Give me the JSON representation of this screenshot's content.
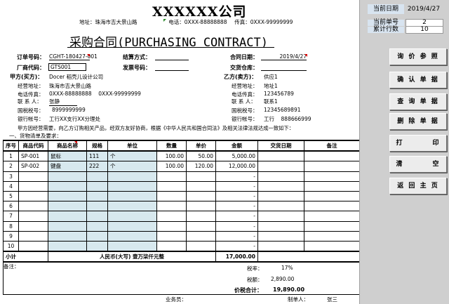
{
  "header": {
    "company": "XXXXXX公司",
    "address_label": "地址：",
    "address": "珠海市吉大景山路",
    "phone_label": "电话：",
    "phone": "0XXX-88888888",
    "fax_label": "传真：",
    "fax": "0XXX-99999999",
    "title": "采购合同(PURCHASING CONTRACT)"
  },
  "meta": {
    "order_no_label": "订单号码：",
    "order_no": "CGHT-180427-001",
    "vendor_code_label": "厂商代码：",
    "vendor_code": "GTS001",
    "settle_label": "结算方式：",
    "settle": "",
    "invoice_label": "发票号码：",
    "invoice": "",
    "date_label": "合同日期：",
    "date": "2019/4/27",
    "warehouse_label": "交货仓库：",
    "warehouse": ""
  },
  "party_a": {
    "label": "甲方(买方)：",
    "name": "Docer 稻壳儿设计公司",
    "addr_label": "经营地址：",
    "addr": "珠海市吉大景山路",
    "phone_label": "电话传真：",
    "phone": "0XXX-88888888    0XXX-99999999",
    "contact_label": "联 系 人：",
    "contact": "张静",
    "tax_label": "国税税号：",
    "tax": "8999999999",
    "bank_label": "银行帐号：",
    "bank": "工行XX支行XX分理处"
  },
  "party_b": {
    "label": "乙方(卖方)：",
    "name": "供应1",
    "addr_label": "经营地址：",
    "addr": "地址1",
    "phone_label": "电话传真：",
    "phone": "123456789",
    "contact_label": "联 系 人：",
    "contact": "联系1",
    "tax_label": "国税税号：",
    "tax": "12345689891",
    "bank_label": "银行帐号：",
    "bank": "工行    888666999"
  },
  "intro": "甲方因经营需要，向乙方订购相关产品，经双方友好协商，根据《中华人民共和国合同法》及相关法律法规达成一致如下：",
  "section": "一、货物清单及要求：",
  "table": {
    "headers": [
      "序号",
      "商品代码",
      "商品名称",
      "规格",
      "单位",
      "数量",
      "单价",
      "金额",
      "交货日期",
      "备注"
    ],
    "rows": [
      [
        "1",
        "SP-001",
        "鼠标",
        "111",
        "个",
        "100.00",
        "50.00",
        "5,000.00",
        "",
        ""
      ],
      [
        "2",
        "SP-002",
        "键盘",
        "222",
        "个",
        "100.00",
        "120.00",
        "12,000.00",
        "",
        ""
      ],
      [
        "3",
        "",
        "",
        "",
        "",
        "",
        "",
        "-",
        "",
        ""
      ],
      [
        "4",
        "",
        "",
        "",
        "",
        "",
        "",
        "-",
        "",
        ""
      ],
      [
        "5",
        "",
        "",
        "",
        "",
        "",
        "",
        "-",
        "",
        ""
      ],
      [
        "6",
        "",
        "",
        "",
        "",
        "",
        "",
        "-",
        "",
        ""
      ],
      [
        "7",
        "",
        "",
        "",
        "",
        "",
        "",
        "-",
        "",
        ""
      ],
      [
        "8",
        "",
        "",
        "",
        "",
        "",
        "",
        "-",
        "",
        ""
      ],
      [
        "9",
        "",
        "",
        "",
        "",
        "",
        "",
        "-",
        "",
        ""
      ],
      [
        "10",
        "",
        "",
        "",
        "",
        "",
        "",
        "-",
        "",
        ""
      ]
    ],
    "subtotal_label": "小计",
    "subtotal_text": "人民币(大写) 壹万柒仟元整",
    "subtotal": "17,000.00"
  },
  "footer": {
    "remark_label": "备注：",
    "tax_rate_label": "税率：",
    "tax_rate": "17%",
    "tax_amt_label": "税额：",
    "tax_amt": "2,890.00",
    "total_label": "价税合计：",
    "total": "19,890.00",
    "clerk_label": "业务员：",
    "maker_label": "制单人：",
    "maker": "张三"
  },
  "panel": {
    "date_label": "当前日期",
    "date": "2019/4/27",
    "current_label": "当前单号",
    "current": "2",
    "total_label": "累计行数",
    "total": "10",
    "buttons": [
      "询 价 参 照",
      "确 认 单 据",
      "查 询 单 据",
      "删 除 单 据",
      "打        印",
      "清        空",
      "返 回 主 页"
    ]
  }
}
